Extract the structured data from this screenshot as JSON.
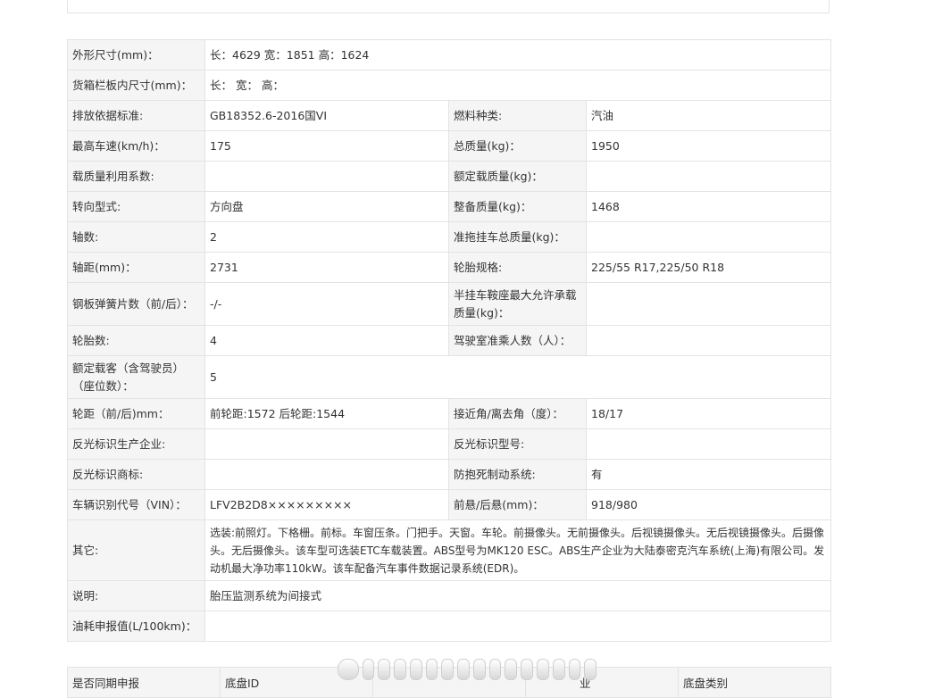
{
  "spec_rows": [
    {
      "label": "外形尺寸(mm)：",
      "value": "长：4629 宽：1851 高：1624"
    },
    {
      "label": "货箱栏板内尺寸(mm)：",
      "value": "长： 宽： 高："
    },
    {
      "label": "排放依据标准:",
      "value": "GB18352.6-2016国VI",
      "label2": "燃料种类:",
      "value2": "汽油"
    },
    {
      "label": "最高车速(km/h)：",
      "value": "175",
      "label2": "总质量(kg)：",
      "value2": "1950"
    },
    {
      "label": "载质量利用系数:",
      "value": "",
      "label2": "额定载质量(kg)：",
      "value2": ""
    },
    {
      "label": "转向型式:",
      "value": "方向盘",
      "label2": "整备质量(kg)：",
      "value2": "1468"
    },
    {
      "label": "轴数:",
      "value": "2",
      "label2": "准拖挂车总质量(kg)：",
      "value2": ""
    },
    {
      "label": "轴距(mm)：",
      "value": "2731",
      "label2": "轮胎规格:",
      "value2": "225/55 R17,225/50 R18"
    },
    {
      "label": "钢板弹簧片数（前/后）：",
      "value": "-/-",
      "label2": "半挂车鞍座最大允许承载质量(kg)：",
      "value2": ""
    },
    {
      "label": "轮胎数:",
      "value": "4",
      "label2": "驾驶室准乘人数（人）：",
      "value2": ""
    },
    {
      "label": "额定载客（含驾驶员）（座位数）：",
      "value": "5"
    },
    {
      "label": "轮距（前/后)mm：",
      "value": "前轮距:1572 后轮距:1544",
      "label2": "接近角/离去角（度）：",
      "value2": "18/17"
    },
    {
      "label": "反光标识生产企业:",
      "value": "",
      "label2": "反光标识型号:",
      "value2": ""
    },
    {
      "label": "反光标识商标:",
      "value": "",
      "label2": "防抱死制动系统:",
      "value2": "有"
    },
    {
      "label": "车辆识别代号（VIN）：",
      "value": "LFV2B2D8×××××××××",
      "label2": "前悬/后悬(mm)：",
      "value2": "918/980"
    },
    {
      "label": "其它:",
      "value": "选装:前照灯。下格栅。前标。车窗压条。门把手。天窗。车轮。前摄像头。无前摄像头。后视镜摄像头。无后视镜摄像头。后摄像头。无后摄像头。该车型可选装ETC车载装置。ABS型号为MK120 ESC。ABS生产企业为大陆泰密克汽车系统(上海)有限公司。发动机最大净功率110kW。该车配备汽车事件数据记录系统(EDR)。"
    },
    {
      "label": "说明:",
      "value": "胎压监测系统为间接式"
    },
    {
      "label": "油耗申报值(L/100km)：",
      "value": ""
    }
  ],
  "bottom_row": {
    "col1": "是否同期申报",
    "col2": "底盘ID",
    "col3": "",
    "col4": "业",
    "col5": "底盘类别"
  }
}
